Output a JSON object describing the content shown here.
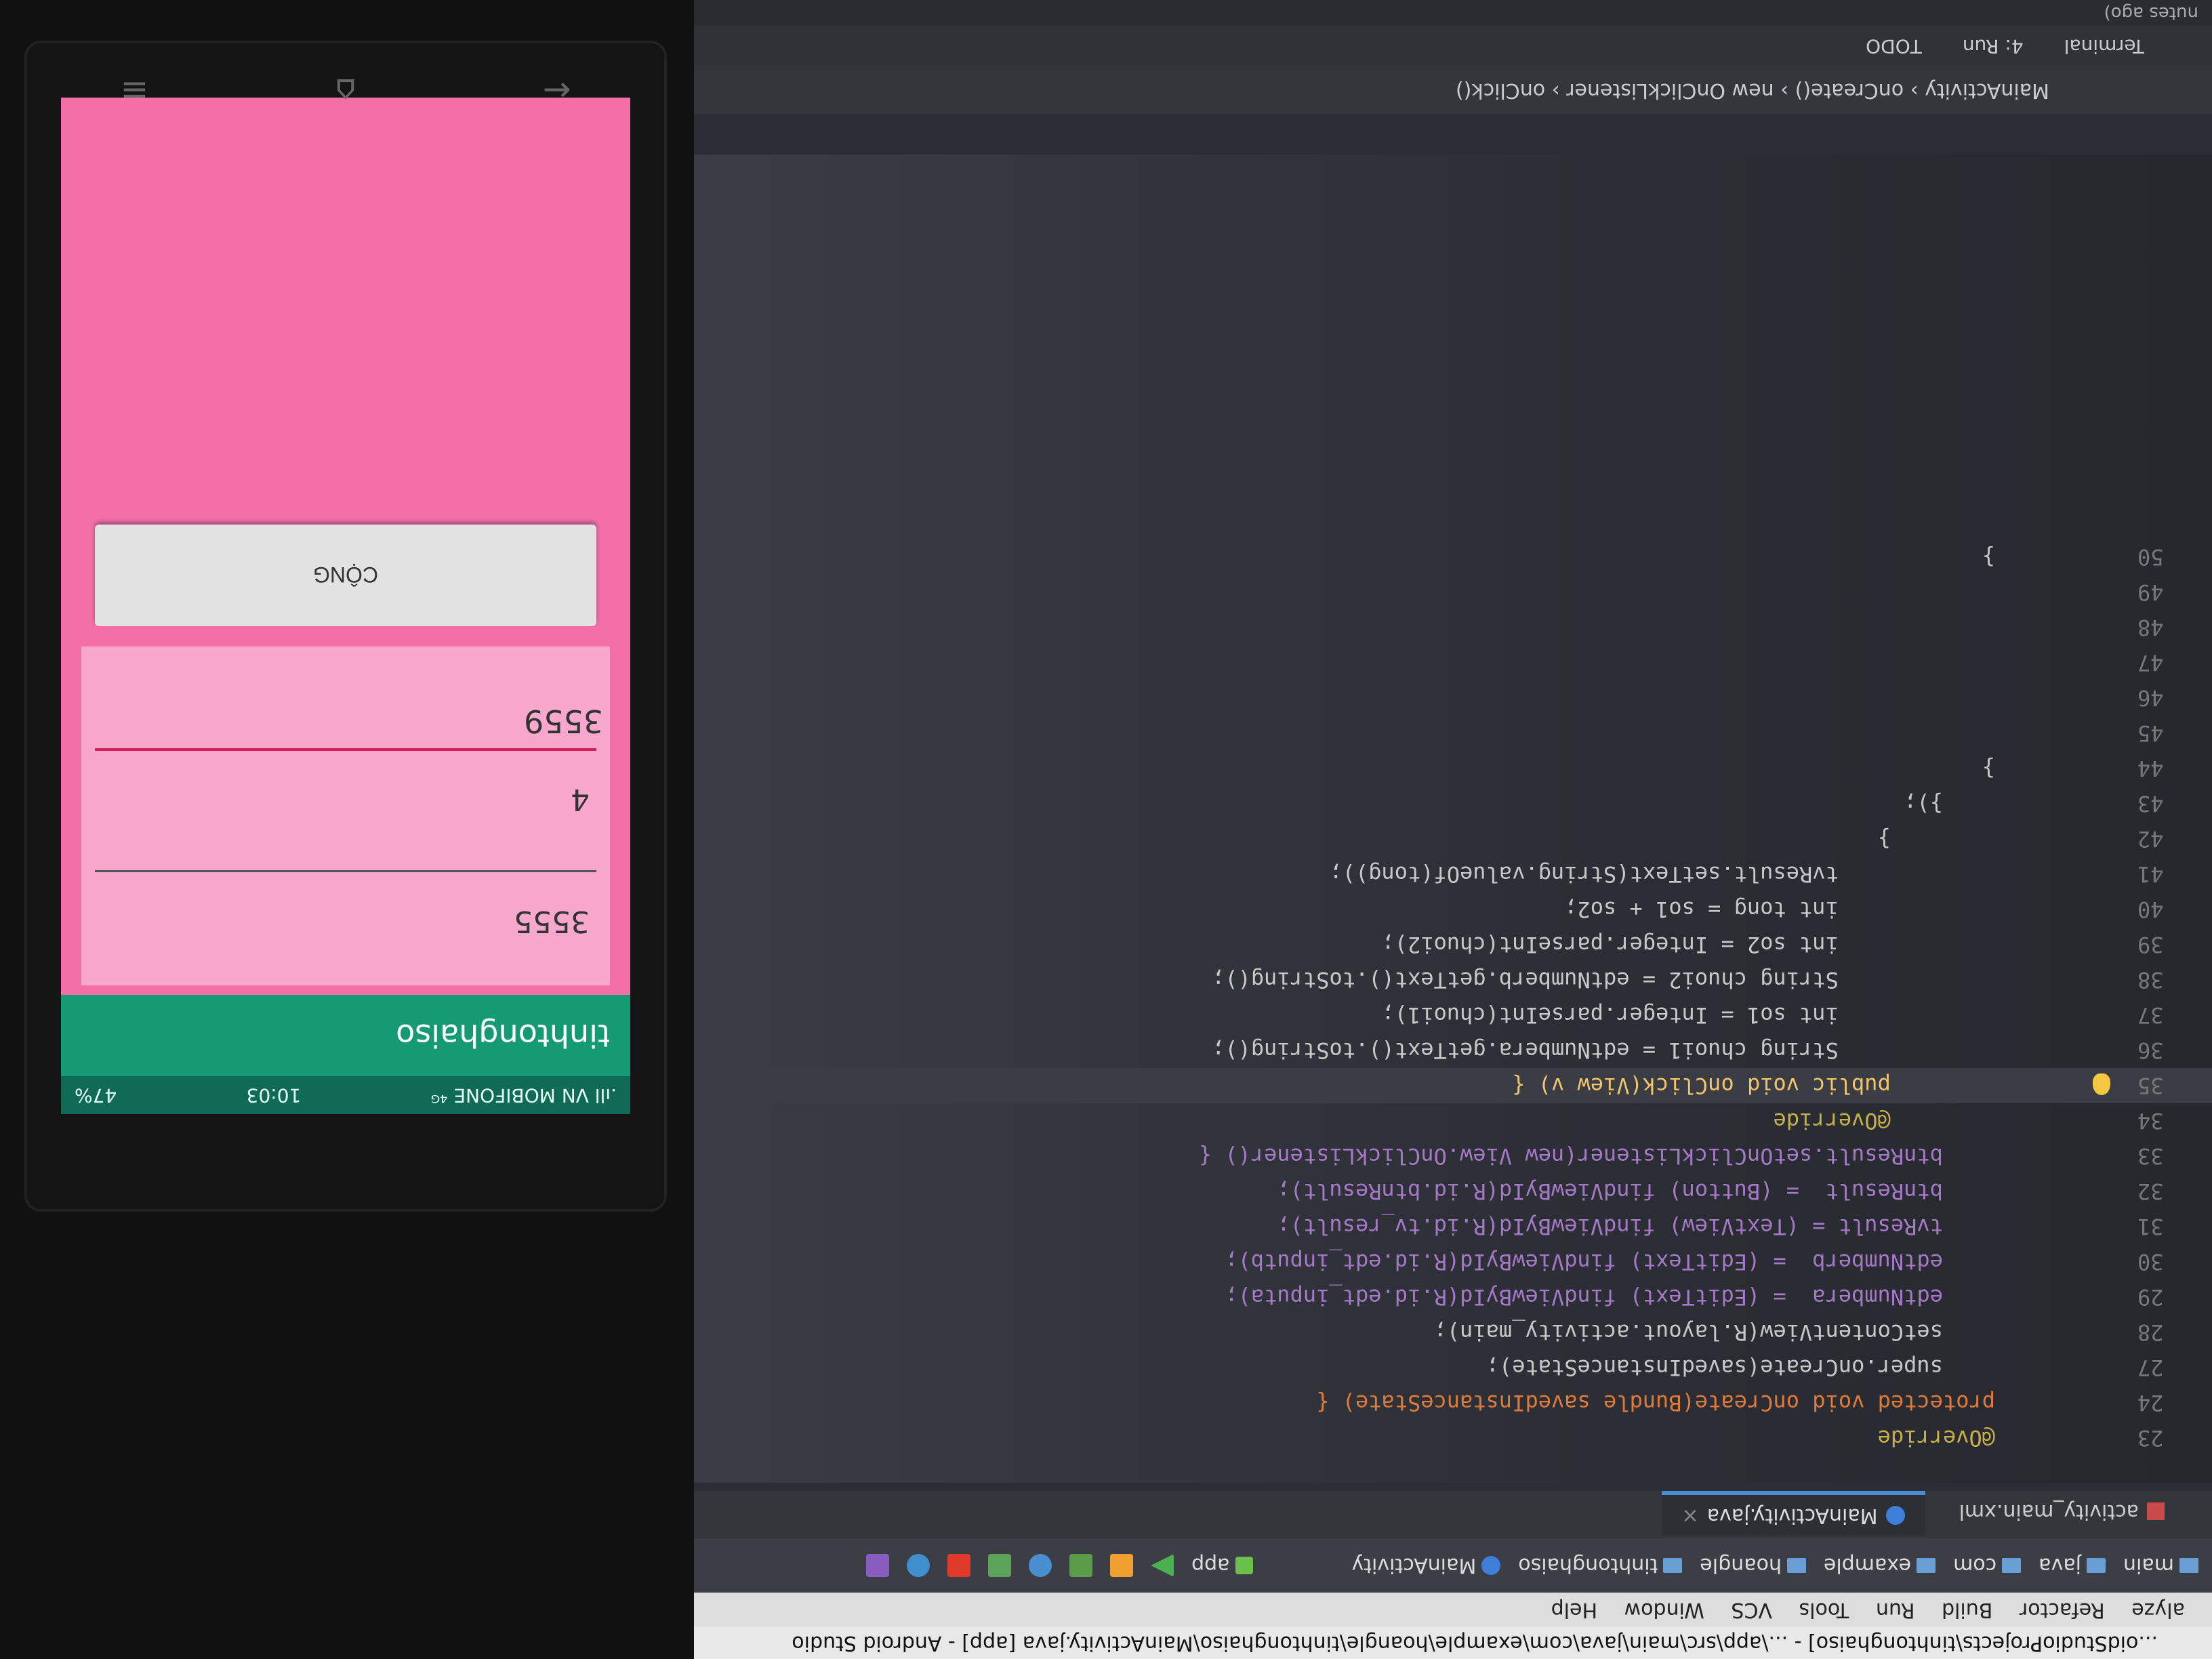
{
  "window": {
    "title": "...oidStudioProjects\\tinhtonghaiso] - ...\\app\\src\\main\\java\\com\\example\\hoangle\\tinhtonghaiso\\MainActivity.java [app] - Android Studio"
  },
  "menu": [
    "alyze",
    "Refactor",
    "Build",
    "Run",
    "Tools",
    "VCS",
    "Window",
    "Help"
  ],
  "nav_crumbs": [
    "main",
    "java",
    "com",
    "example",
    "hoangle",
    "tinhtonghaiso",
    "MainActivity"
  ],
  "toolbar": {
    "config": "app"
  },
  "tabs": [
    {
      "label": "activity_main.xml"
    },
    {
      "label": "MainActivity.java"
    }
  ],
  "code": [
    {
      "n": "23",
      "text": "@Override"
    },
    {
      "n": "24",
      "text": "protected void onCreate(Bundle savedInstanceState) {"
    },
    {
      "n": "27",
      "text": "    super.onCreate(savedInstanceState);"
    },
    {
      "n": "28",
      "text": "    setContentView(R.layout.activity_main);"
    },
    {
      "n": "29",
      "text": "    edtNumbera  = (EditText) findViewById(R.id.edt_inputa);"
    },
    {
      "n": "30",
      "text": "    edtNumberb  = (EditText) findViewById(R.id.edt_inputb);"
    },
    {
      "n": "31",
      "text": "    tvResult = (TextView) findViewById(R.id.tv_result);"
    },
    {
      "n": "32",
      "text": "    btnResult  = (Button) findViewById(R.id.btnResult);"
    },
    {
      "n": "33",
      "text": "    btnResult.setOnClickListener(new View.OnClickListener() {"
    },
    {
      "n": "34",
      "text": "        @Override"
    },
    {
      "n": "35",
      "text": "        public void onClick(View v) {"
    },
    {
      "n": "36",
      "text": "            String chuoi1 = edtNumbera.getText().toString();"
    },
    {
      "n": "37",
      "text": "            int so1 = Integer.parseInt(chuoi1);"
    },
    {
      "n": "38",
      "text": "            String chuoi2 = edtNumberb.getText().toString();"
    },
    {
      "n": "39",
      "text": "            int so2 = Integer.parseInt(chuoi2);"
    },
    {
      "n": "40",
      "text": "            int tong = so1 + so2;"
    },
    {
      "n": "41",
      "text": "            tvResult.setText(String.valueOf(tong));"
    },
    {
      "n": "42",
      "text": "        }"
    },
    {
      "n": "43",
      "text": "    });"
    },
    {
      "n": "44",
      "text": "}"
    },
    {
      "n": "45",
      "text": ""
    },
    {
      "n": "46",
      "text": ""
    },
    {
      "n": "47",
      "text": ""
    },
    {
      "n": "48",
      "text": ""
    },
    {
      "n": "49",
      "text": ""
    },
    {
      "n": "50",
      "text": "}"
    }
  ],
  "breadcrumbs": "MainActivity  ›  onCreate()  ›  new OnClickListener  ›  onClick()",
  "toolwindows": [
    "Terminal",
    "4: Run",
    "TODO"
  ],
  "status": "nutes ago)",
  "phone": {
    "status_left": ".ıll VN MOBIFONE ⁴ᴳ",
    "time": "10:03",
    "battery": "47%",
    "app_title": "tinhtonghaiso",
    "input_a": "3555",
    "input_b": "4",
    "result": "3559",
    "button": "CỘNG"
  }
}
